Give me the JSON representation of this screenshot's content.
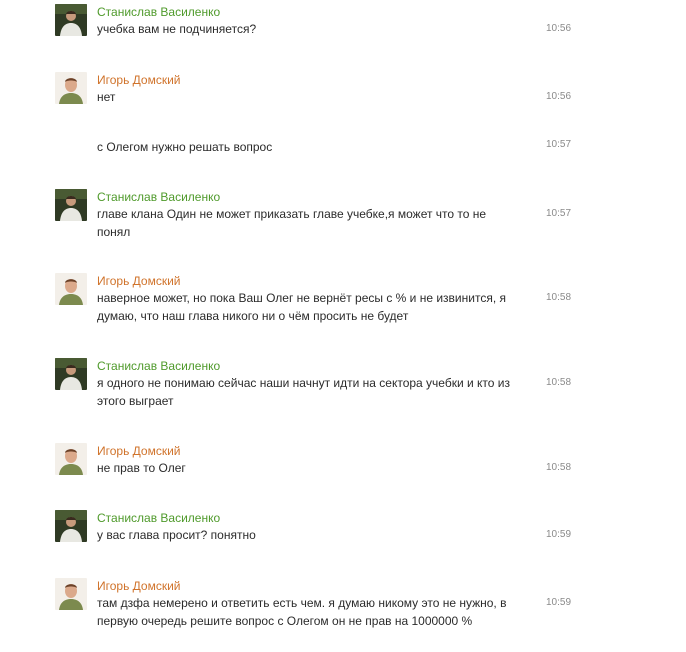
{
  "colors": {
    "author_stanislav": "#4f9a2b",
    "author_igor": "#d0732b",
    "message_text": "#2b2b2b",
    "timestamp": "#8a8a8a"
  },
  "messages": [
    {
      "author": "Станислав Василенко",
      "avatar": "stanislav-avatar",
      "text": "учебка вам не подчиняется?",
      "time": "10:56"
    },
    {
      "author": "Игорь Домский",
      "avatar": "igor-avatar",
      "text": "нет",
      "time": "10:56"
    },
    {
      "author": "",
      "avatar": "",
      "text": "с Олегом нужно решать вопрос",
      "time": "10:57"
    },
    {
      "author": "Станислав Василенко",
      "avatar": "stanislav-avatar",
      "text": "главе клана Один не может приказать главе учебке,я может что то не понял",
      "time": "10:57"
    },
    {
      "author": "Игорь Домский",
      "avatar": "igor-avatar",
      "text": "наверное может, но пока Ваш  Олег не вернёт ресы с % и не извинится, я думаю, что наш глава никого ни о чём просить не будет",
      "time": "10:58"
    },
    {
      "author": "Станислав Василенко",
      "avatar": "stanislav-avatar",
      "text": "я одного не понимаю сейчас наши начнут идти на сектора учебки и кто из этого выграет",
      "time": "10:58"
    },
    {
      "author": "Игорь Домский",
      "avatar": "igor-avatar",
      "text": "не прав то Олег",
      "time": "10:58"
    },
    {
      "author": "Станислав Василенко",
      "avatar": "stanislav-avatar",
      "text": "у вас глава просит? понятно",
      "time": "10:59"
    },
    {
      "author": "Игорь Домский",
      "avatar": "igor-avatar",
      "text": "там дзфа немерено и ответить есть чем. я думаю никому это не нужно, в первую очередь решите вопрос с Олегом  он не прав на 1000000 %",
      "time": "10:59"
    }
  ]
}
